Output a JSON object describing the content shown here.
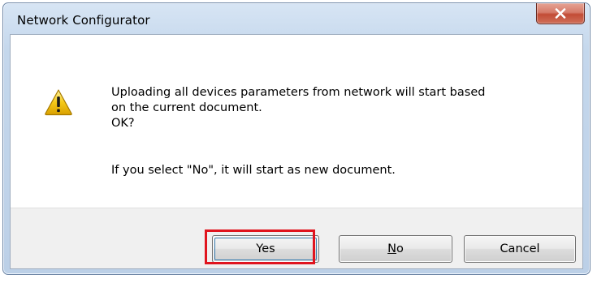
{
  "window": {
    "title": "Network Configurator",
    "close_icon": "close-icon"
  },
  "dialog": {
    "icon": "warning-icon",
    "message_line1": "Uploading all devices parameters from network will start based",
    "message_line2": "on the current document.",
    "message_line3": "OK?",
    "message_line4": "If you select \"No\", it will start as new document."
  },
  "buttons": {
    "yes_label": "Yes",
    "no_label_mnemonic": "N",
    "no_label_rest": "o",
    "cancel_label": "Cancel"
  },
  "colors": {
    "highlight": "#e0141e",
    "titlebar": "#c4d7ec",
    "close_button": "#c24c36"
  }
}
